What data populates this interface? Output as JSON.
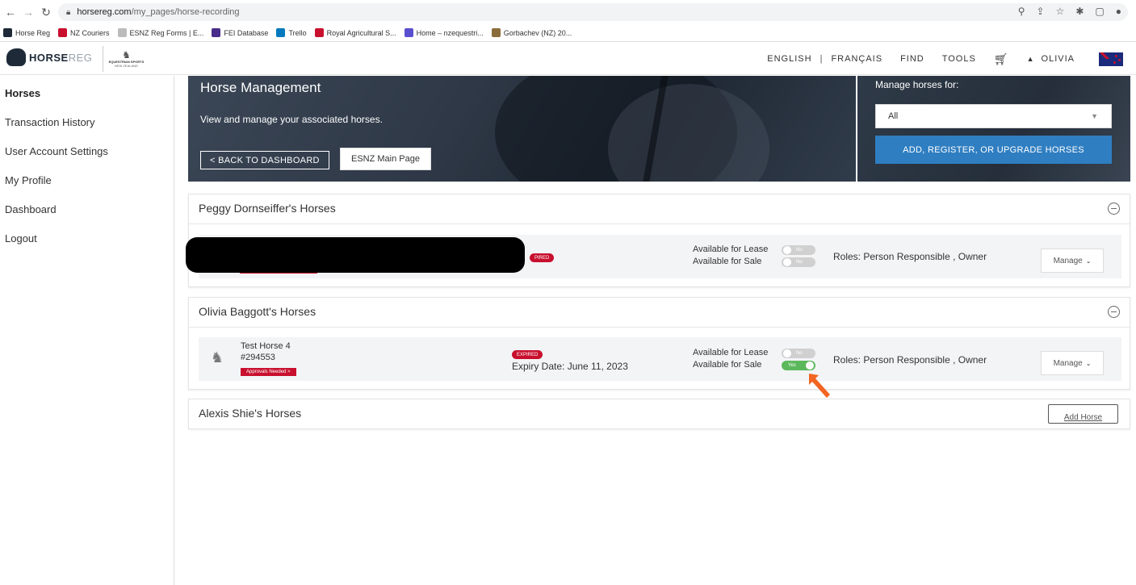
{
  "browser": {
    "url_host": "horsereg.com",
    "url_path": "/my_pages/horse-recording",
    "bookmarks": [
      {
        "label": "Horse Reg",
        "color": "#1e2a38"
      },
      {
        "label": "NZ Couriers",
        "color": "#c8102e"
      },
      {
        "label": "ESNZ Reg Forms | E...",
        "color": "#888888"
      },
      {
        "label": "FEI Database",
        "color": "#4a2c8a"
      },
      {
        "label": "Trello",
        "color": "#0079bf"
      },
      {
        "label": "Royal Agricultural S...",
        "color": "#c8102e"
      },
      {
        "label": "Home – nzequestri...",
        "color": "#5a4fcf"
      },
      {
        "label": "Gorbachev (NZ) 20...",
        "color": "#8a6d3b"
      }
    ]
  },
  "header": {
    "logo_main": "HORSE",
    "logo_accent": "REG",
    "esnz_line1": "EQUESTRIAN SPORTS",
    "esnz_line2": "NEW ZEALAND",
    "nav": {
      "english": "ENGLISH",
      "separator": "|",
      "french": "FRANÇAIS",
      "find": "FIND",
      "tools": "TOOLS",
      "user": "OLIVIA"
    }
  },
  "sidebar": {
    "items": [
      {
        "label": "Horses",
        "active": true
      },
      {
        "label": "Transaction History",
        "active": false
      },
      {
        "label": "User Account Settings",
        "active": false
      },
      {
        "label": "My Profile",
        "active": false
      },
      {
        "label": "Dashboard",
        "active": false
      },
      {
        "label": "Logout",
        "active": false
      }
    ]
  },
  "hero": {
    "title": "Horse Management",
    "subtitle": "View and manage your associated horses.",
    "back_button": "< BACK TO DASHBOARD",
    "esnz_button": "ESNZ Main Page"
  },
  "manage_panel": {
    "label": "Manage horses for:",
    "selected": "All",
    "add_button": "ADD, REGISTER, OR UPGRADE HORSES"
  },
  "owners": [
    {
      "title": "Peggy Dornseiffer's Horses",
      "horse": {
        "status_badge": "PIRED",
        "lease_label": "Available for Lease",
        "lease_toggle": "No",
        "sale_label": "Available for Sale",
        "sale_toggle": "No",
        "roles": "Roles: Person Responsible , Owner",
        "manage": "Manage"
      }
    },
    {
      "title": "Olivia Baggott's Horses",
      "horse": {
        "name": "Test Horse 4",
        "number": "#294553",
        "approvals": "Approvals Needed >",
        "status_badge": "EXPIRED",
        "expiry": "Expiry Date: June 11, 2023",
        "lease_label": "Available for Lease",
        "lease_toggle": "No",
        "sale_label": "Available for Sale",
        "sale_toggle": "Yes",
        "roles": "Roles: Person Responsible , Owner",
        "manage": "Manage"
      }
    },
    {
      "title": "Alexis Shie's Horses",
      "add_button": "Add Horse"
    }
  ],
  "colors": {
    "brand_dark": "#1e2a38",
    "accent_blue": "#2f7ec1",
    "badge_red": "#c8102e",
    "toggle_green": "#5cb85c",
    "arrow_orange": "#f26522"
  }
}
